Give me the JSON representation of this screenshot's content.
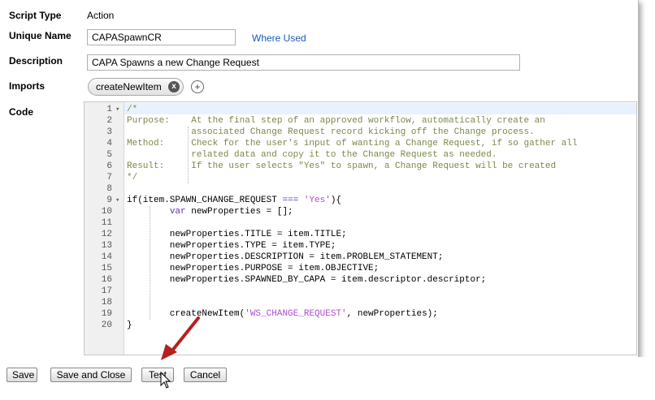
{
  "form": {
    "script_type_label": "Script Type",
    "script_type_value": "Action",
    "unique_name_label": "Unique Name",
    "unique_name_value": "CAPASpawnCR",
    "where_used_link": "Where Used",
    "description_label": "Description",
    "description_value": "CAPA Spawns a new Change Request",
    "imports_label": "Imports",
    "import_chip": "createNewItem",
    "add_import_icon": "+",
    "remove_chip_icon": "x",
    "code_label": "Code"
  },
  "code_lines": [
    {
      "n": "1",
      "fold": "▾",
      "t": "/*"
    },
    {
      "n": "2",
      "t": "Purpose:    At the final step of an approved workflow, automatically create an"
    },
    {
      "n": "3",
      "t": "            associated Change Request record kicking off the Change process."
    },
    {
      "n": "4",
      "t": "Method:     Check for the user's input of wanting a Change Request, if so gather all"
    },
    {
      "n": "5",
      "t": "            related data and copy it to the Change Request as needed."
    },
    {
      "n": "6",
      "t": "Result:     If the user selects \"Yes\" to spawn, a Change Request will be created"
    },
    {
      "n": "7",
      "t": "*/"
    },
    {
      "n": "8",
      "t": ""
    },
    {
      "n": "9",
      "fold": "▾",
      "t": "if(item.SPAWN_CHANGE_REQUEST === 'Yes'){"
    },
    {
      "n": "10",
      "t": "        var newProperties = [];"
    },
    {
      "n": "11",
      "t": ""
    },
    {
      "n": "12",
      "t": "        newProperties.TITLE = item.TITLE;"
    },
    {
      "n": "13",
      "t": "        newProperties.TYPE = item.TYPE;"
    },
    {
      "n": "14",
      "t": "        newProperties.DESCRIPTION = item.PROBLEM_STATEMENT;"
    },
    {
      "n": "15",
      "t": "        newProperties.PURPOSE = item.OBJECTIVE;"
    },
    {
      "n": "16",
      "t": "        newProperties.SPAWNED_BY_CAPA = item.descriptor.descriptor;"
    },
    {
      "n": "17",
      "t": ""
    },
    {
      "n": "18",
      "t": ""
    },
    {
      "n": "19",
      "t": "        createNewItem('WS_CHANGE_REQUEST', newProperties);"
    },
    {
      "n": "20",
      "t": "}"
    }
  ],
  "buttons": {
    "save": "Save",
    "save_close": "Save and Close",
    "test": "Test",
    "cancel": "Cancel"
  },
  "colors": {
    "link": "#1a5bb8",
    "comment": "#7a8a4a",
    "keyword": "#5a2cc2",
    "string": "#b04cd0",
    "arrow": "#b52020"
  },
  "icons": {
    "arrow": "red-arrow-icon",
    "cursor": "mouse-pointer-icon"
  }
}
